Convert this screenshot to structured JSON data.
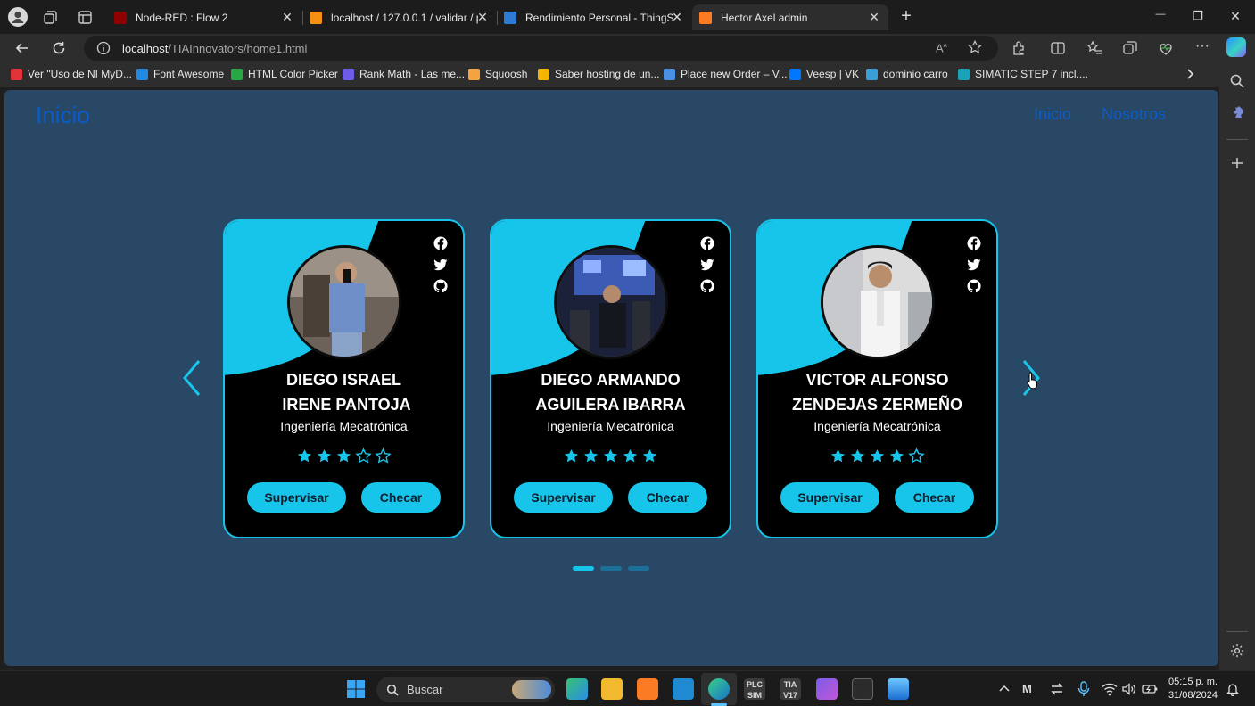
{
  "browser": {
    "tabs": [
      {
        "title": "Node-RED : Flow 2",
        "favicon_color": "#8f0000",
        "close": "✕"
      },
      {
        "title": "localhost / 127.0.0.1 / validar / pe",
        "favicon_color": "#f29111",
        "close": "✕"
      },
      {
        "title": "Rendimiento Personal - ThingSpe",
        "favicon_color": "#2e7bd4",
        "close": "✕"
      },
      {
        "title": "Hector Axel admin",
        "favicon_color": "#fb7a24",
        "close": "✕",
        "active": true
      }
    ],
    "new_tab": "+",
    "window_controls": {
      "minimize": "—",
      "maximize": "❐",
      "close": "✕"
    },
    "address": {
      "host": "localhost",
      "path": "/TIAInnovators/home1.html"
    },
    "bookmarks": [
      {
        "label": "Ver \"Uso de NI MyD...",
        "color": "#e2333a"
      },
      {
        "label": "Font Awesome",
        "color": "#228ae6"
      },
      {
        "label": "HTML Color Picker",
        "color": "#27a844"
      },
      {
        "label": "Rank Math - Las me...",
        "color": "#6c5ce7"
      },
      {
        "label": "Squoosh",
        "color": "#f4a340"
      },
      {
        "label": "Saber hosting de un...",
        "color": "#f4b400"
      },
      {
        "label": "Place new Order – V...",
        "color": "#4a90e2"
      },
      {
        "label": "Veesp | VK",
        "color": "#0077ff"
      },
      {
        "label": "dominio carro",
        "color": "#3a9fd6"
      },
      {
        "label": "SIMATIC STEP 7 incl....",
        "color": "#1aa3b8"
      }
    ]
  },
  "page": {
    "brand": "Inicio",
    "nav": [
      "Inicio",
      "Nosotros"
    ],
    "cards": [
      {
        "name_line1": "DIEGO ISRAEL",
        "name_line2": "IRENE PANTOJA",
        "role": "Ingeniería Mecatrónica",
        "rating": 3,
        "btn_primary": "Supervisar",
        "btn_secondary": "Checar"
      },
      {
        "name_line1": "DIEGO ARMANDO",
        "name_line2": "AGUILERA IBARRA",
        "role": "Ingeniería Mecatrónica",
        "rating": 5,
        "btn_primary": "Supervisar",
        "btn_secondary": "Checar"
      },
      {
        "name_line1": "VICTOR ALFONSO",
        "name_line2": "ZENDEJAS ZERMEÑO",
        "role": "Ingeniería Mecatrónica",
        "rating": 4,
        "btn_primary": "Supervisar",
        "btn_secondary": "Checar"
      }
    ],
    "slider_pages": 3,
    "active_page": 1
  },
  "taskbar": {
    "search_placeholder": "Buscar",
    "time": "05:15 p. m.",
    "date": "31/08/2024"
  },
  "colors": {
    "accent": "#18c5ea",
    "page_bg": "#284865",
    "nav_link": "#0a5ccc"
  }
}
